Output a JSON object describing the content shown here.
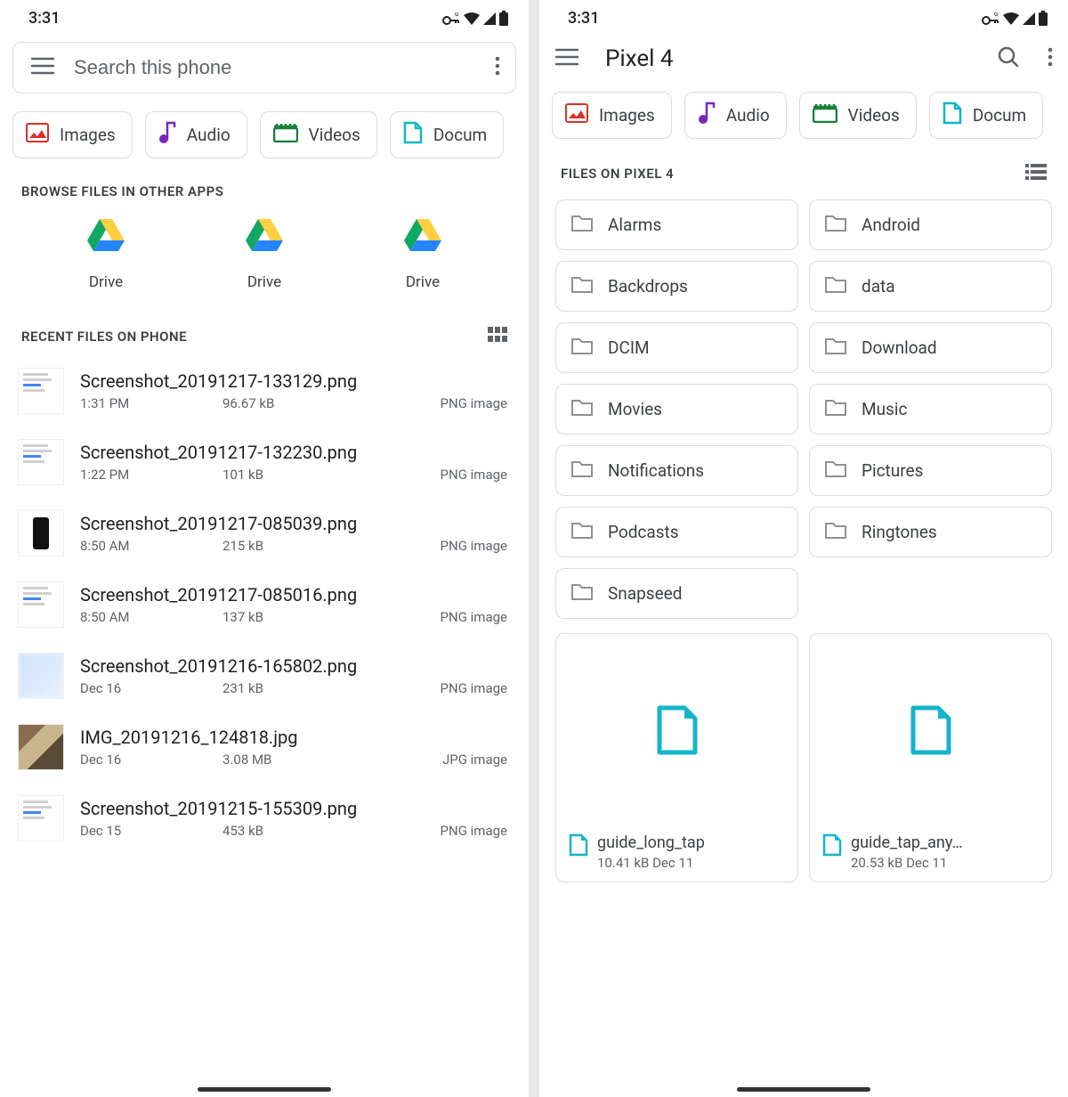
{
  "status": {
    "time": "3:31"
  },
  "left": {
    "searchPlaceholder": "Search this phone",
    "chips": [
      {
        "label": "Images",
        "color": "#d93025",
        "type": "image"
      },
      {
        "label": "Audio",
        "color": "#7627bb",
        "type": "audio"
      },
      {
        "label": "Videos",
        "color": "#188038",
        "type": "video"
      },
      {
        "label": "Docum",
        "color": "#12b5cb",
        "type": "doc"
      }
    ],
    "browseHeader": "BROWSE FILES IN OTHER APPS",
    "drives": [
      "Drive",
      "Drive",
      "Drive"
    ],
    "recentHeader": "RECENT FILES ON PHONE",
    "files": [
      {
        "name": "Screenshot_20191217-133129.png",
        "time": "1:31 PM",
        "size": "96.67 kB",
        "type": "PNG image",
        "thumb": "doc1"
      },
      {
        "name": "Screenshot_20191217-132230.png",
        "time": "1:22 PM",
        "size": "101 kB",
        "type": "PNG image",
        "thumb": "doc2"
      },
      {
        "name": "Screenshot_20191217-085039.png",
        "time": "8:50 AM",
        "size": "215 kB",
        "type": "PNG image",
        "thumb": "phone"
      },
      {
        "name": "Screenshot_20191217-085016.png",
        "time": "8:50 AM",
        "size": "137 kB",
        "type": "PNG image",
        "thumb": "doc3"
      },
      {
        "name": "Screenshot_20191216-165802.png",
        "time": "Dec 16",
        "size": "231 kB",
        "type": "PNG image",
        "thumb": "blur"
      },
      {
        "name": "IMG_20191216_124818.jpg",
        "time": "Dec 16",
        "size": "3.08 MB",
        "type": "JPG image",
        "thumb": "photo"
      },
      {
        "name": "Screenshot_20191215-155309.png",
        "time": "Dec 15",
        "size": "453 kB",
        "type": "PNG image",
        "thumb": "doc4"
      }
    ]
  },
  "right": {
    "title": "Pixel 4",
    "chips": [
      {
        "label": "Images",
        "color": "#d93025",
        "type": "image"
      },
      {
        "label": "Audio",
        "color": "#7627bb",
        "type": "audio"
      },
      {
        "label": "Videos",
        "color": "#188038",
        "type": "video"
      },
      {
        "label": "Docum",
        "color": "#12b5cb",
        "type": "doc"
      }
    ],
    "filesHeader": "FILES ON PIXEL 4",
    "folders": [
      "Alarms",
      "Android",
      "Backdrops",
      "data",
      "DCIM",
      "Download",
      "Movies",
      "Music",
      "Notifications",
      "Pictures",
      "Podcasts",
      "Ringtones",
      "Snapseed"
    ],
    "gridFiles": [
      {
        "name": "guide_long_tap",
        "meta": "10.41 kB Dec 11"
      },
      {
        "name": "guide_tap_any…",
        "meta": "20.53 kB Dec 11"
      }
    ]
  }
}
